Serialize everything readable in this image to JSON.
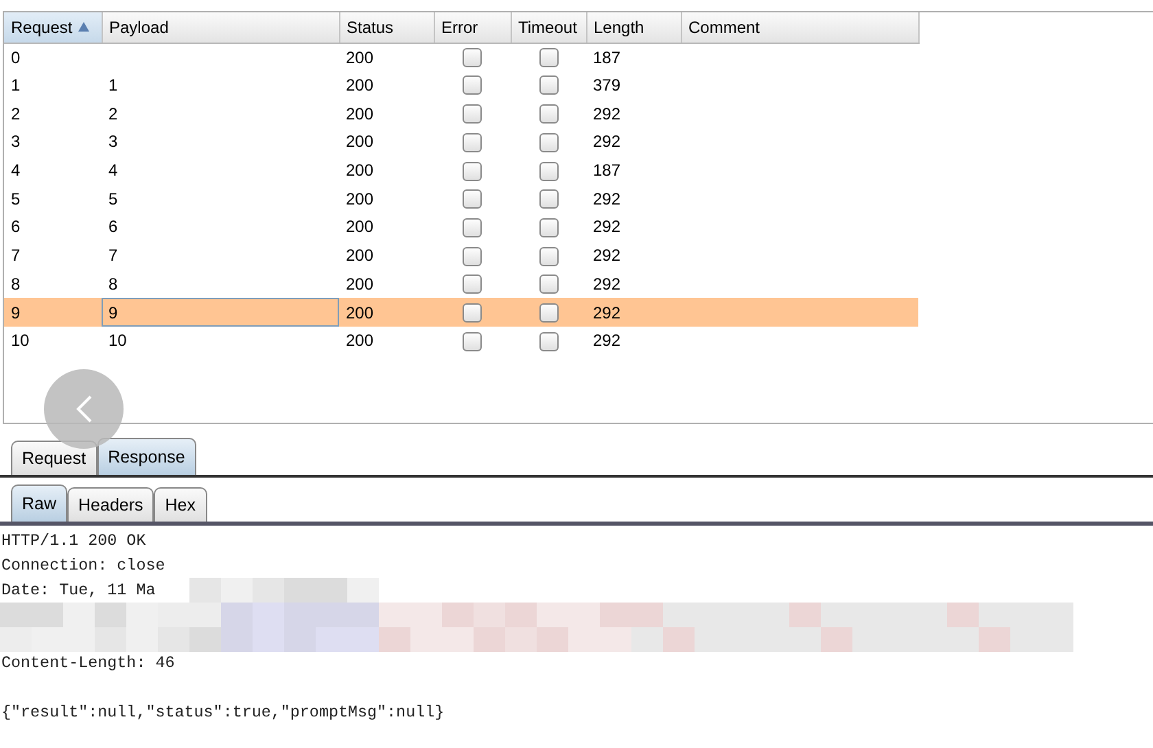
{
  "results_table": {
    "columns": [
      {
        "label": "Request",
        "sorted": true
      },
      {
        "label": "Payload",
        "sorted": false
      },
      {
        "label": "Status",
        "sorted": false
      },
      {
        "label": "Error",
        "sorted": false
      },
      {
        "label": "Timeout",
        "sorted": false
      },
      {
        "label": "Length",
        "sorted": false
      },
      {
        "label": "Comment",
        "sorted": false
      }
    ],
    "rows": [
      {
        "request": "0",
        "status": "200",
        "error": false,
        "timeout": false,
        "length": "187",
        "selected": false
      },
      {
        "request": "1",
        "payload": "1",
        "status": "200",
        "error": false,
        "timeout": false,
        "length": "379",
        "selected": false
      },
      {
        "request": "2",
        "payload": "2",
        "status": "200",
        "error": false,
        "timeout": false,
        "length": "292",
        "selected": false
      },
      {
        "request": "3",
        "payload": "3",
        "status": "200",
        "error": false,
        "timeout": false,
        "length": "292",
        "selected": false
      },
      {
        "request": "4",
        "payload": "4",
        "status": "200",
        "error": false,
        "timeout": false,
        "length": "187",
        "selected": false
      },
      {
        "request": "5",
        "payload": "5",
        "status": "200",
        "error": false,
        "timeout": false,
        "length": "292",
        "selected": false
      },
      {
        "request": "6",
        "payload": "6",
        "status": "200",
        "error": false,
        "timeout": false,
        "length": "292",
        "selected": false
      },
      {
        "request": "7",
        "payload": "7",
        "status": "200",
        "error": false,
        "timeout": false,
        "length": "292",
        "selected": false
      },
      {
        "request": "8",
        "payload": "8",
        "status": "200",
        "error": false,
        "timeout": false,
        "length": "292",
        "selected": false
      },
      {
        "request": "9",
        "payload": "9",
        "status": "200",
        "error": false,
        "timeout": false,
        "length": "292",
        "selected": true
      },
      {
        "request": "10",
        "payload": "10",
        "status": "200",
        "error": false,
        "timeout": false,
        "length": "292",
        "selected": false
      }
    ]
  },
  "message_tabs": [
    {
      "label": "Request",
      "selected": false
    },
    {
      "label": "Response",
      "selected": true
    }
  ],
  "view_tabs": [
    {
      "label": "Raw",
      "selected": true
    },
    {
      "label": "Headers",
      "selected": false
    },
    {
      "label": "Hex",
      "selected": false
    }
  ],
  "response_lines": [
    {
      "kind": "text",
      "text": "HTTP/1.1 200 OK"
    },
    {
      "kind": "text",
      "text": "Connection: close"
    },
    {
      "kind": "text",
      "text": "Date: Tue, 11 Ma"
    },
    {
      "kind": "redacted"
    },
    {
      "kind": "redacted"
    },
    {
      "kind": "text",
      "text": "Content-Length: 46"
    },
    {
      "kind": "blank"
    },
    {
      "kind": "text",
      "text": "{\"result\":null,\"status\":true,\"promptMsg\":null}"
    }
  ]
}
